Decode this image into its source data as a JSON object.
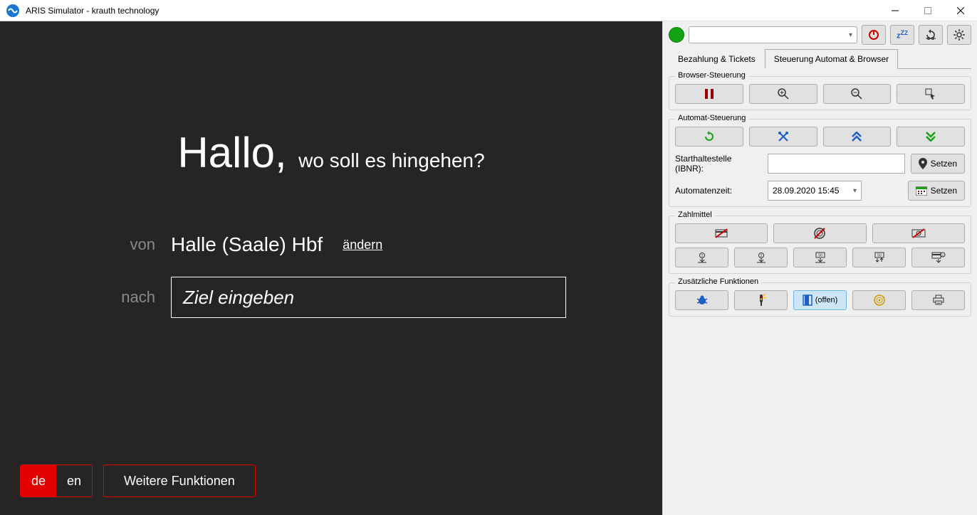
{
  "window": {
    "title": "ARIS Simulator - krauth technology"
  },
  "left": {
    "greeting_big": "Hallo,",
    "greeting_sub": "wo soll es hingehen?",
    "from_label": "von",
    "from_value": "Halle (Saale) Hbf",
    "change": "ändern",
    "to_label": "nach",
    "dest_placeholder": "Ziel eingeben",
    "lang_de": "de",
    "lang_en": "en",
    "more_functions": "Weitere Funktionen"
  },
  "right": {
    "tabs": {
      "payment": "Bezahlung & Tickets",
      "control": "Steuerung Automat & Browser"
    },
    "group_browser": "Browser-Steuerung",
    "group_automat": "Automat-Steuerung",
    "start_stop_label": "Starthaltestelle (IBNR):",
    "start_stop_set": "Setzen",
    "time_label": "Automatenzeit:",
    "time_value": "28.09.2020 15:45",
    "time_set": "Setzen",
    "group_payment": "Zahlmittel",
    "group_extra": "Zusätzliche Funktionen",
    "offen": "(offen)"
  }
}
